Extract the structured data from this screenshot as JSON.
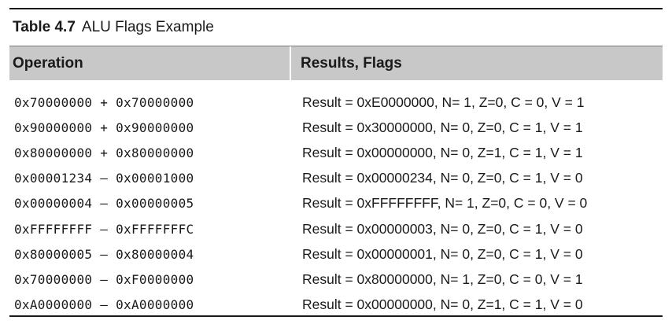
{
  "caption": {
    "number": "Table 4.7",
    "title": "ALU Flags Example"
  },
  "header": {
    "operation": "Operation",
    "results": "Results, Flags"
  },
  "rows": [
    {
      "operation": "0x70000000 + 0x70000000",
      "result": "Result = 0xE0000000, N= 1, Z=0, C = 0, V = 1"
    },
    {
      "operation": "0x90000000 + 0x90000000",
      "result": "Result = 0x30000000, N= 0, Z=0, C = 1, V = 1"
    },
    {
      "operation": "0x80000000 + 0x80000000",
      "result": "Result = 0x00000000, N= 0, Z=1, C = 1, V = 1"
    },
    {
      "operation": "0x00001234 – 0x00001000",
      "result": "Result = 0x00000234, N= 0, Z=0, C = 1, V = 0"
    },
    {
      "operation": "0x00000004 – 0x00000005",
      "result": "Result = 0xFFFFFFFF, N= 1, Z=0, C = 0, V = 0"
    },
    {
      "operation": "0xFFFFFFFF – 0xFFFFFFFC",
      "result": "Result = 0x00000003, N= 0, Z=0, C = 1, V = 0"
    },
    {
      "operation": "0x80000005 – 0x80000004",
      "result": "Result = 0x00000001, N= 0, Z=0, C = 1, V = 0"
    },
    {
      "operation": "0x70000000 – 0xF0000000",
      "result": "Result = 0x80000000, N= 1, Z=0, C = 0, V = 1"
    },
    {
      "operation": "0xA0000000 – 0xA0000000",
      "result": "Result = 0x00000000, N= 0, Z=1, C = 1, V = 0"
    }
  ]
}
